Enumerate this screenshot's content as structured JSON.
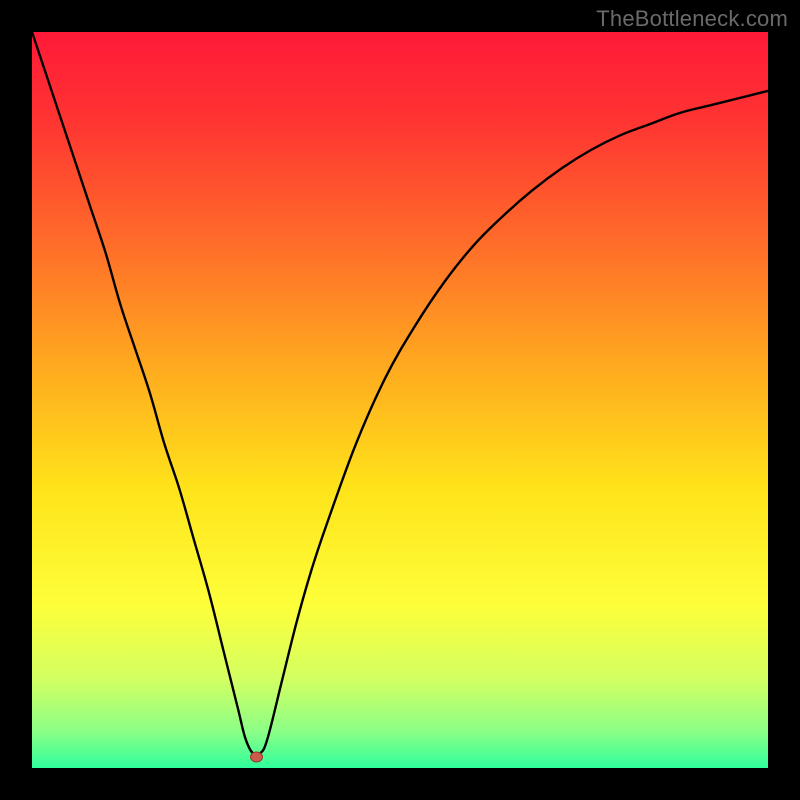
{
  "watermark": "TheBottleneck.com",
  "colors": {
    "frame": "#000000",
    "curve": "#000000",
    "marker_fill": "#cc5b4c",
    "marker_stroke": "#8e3b30",
    "gradient_stops": [
      {
        "offset": 0.0,
        "color": "#ff1938"
      },
      {
        "offset": 0.12,
        "color": "#ff3432"
      },
      {
        "offset": 0.28,
        "color": "#ff6a2a"
      },
      {
        "offset": 0.45,
        "color": "#ffa81f"
      },
      {
        "offset": 0.62,
        "color": "#ffe31a"
      },
      {
        "offset": 0.78,
        "color": "#fdff3a"
      },
      {
        "offset": 0.88,
        "color": "#d2ff62"
      },
      {
        "offset": 0.95,
        "color": "#8cff86"
      },
      {
        "offset": 1.0,
        "color": "#2fff9c"
      }
    ]
  },
  "chart_data": {
    "type": "line",
    "title": "",
    "xlabel": "",
    "ylabel": "",
    "xlim": [
      0,
      100
    ],
    "ylim": [
      0,
      100
    ],
    "marker": {
      "x": 30.5,
      "y": 1.5
    },
    "series": [
      {
        "name": "curve",
        "x": [
          0,
          2,
          4,
          6,
          8,
          10,
          12,
          14,
          16,
          18,
          20,
          22,
          24,
          26,
          27,
          28,
          29,
          30,
          31,
          32,
          34,
          36,
          38,
          40,
          44,
          48,
          52,
          56,
          60,
          64,
          68,
          72,
          76,
          80,
          84,
          88,
          92,
          96,
          100
        ],
        "y": [
          100,
          94,
          88,
          82,
          76,
          70,
          63,
          57,
          51,
          44,
          38,
          31,
          24,
          16,
          12,
          8,
          4,
          2,
          2,
          4,
          12,
          20,
          27,
          33,
          44,
          53,
          60,
          66,
          71,
          75,
          78.5,
          81.5,
          84,
          86,
          87.5,
          89,
          90,
          91,
          92
        ]
      }
    ]
  }
}
